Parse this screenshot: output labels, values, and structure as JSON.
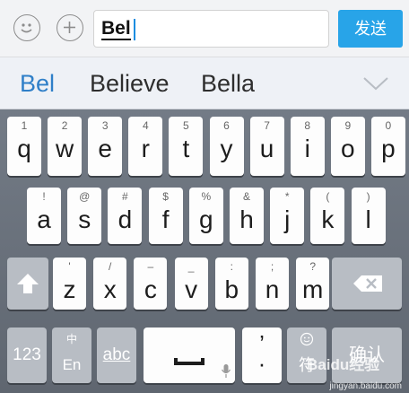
{
  "composer": {
    "input_value": "Bel",
    "send_label": "发送"
  },
  "candidates": [
    "Bel",
    "Believe",
    "Bella"
  ],
  "keyboard": {
    "row1": [
      {
        "hint": "1",
        "key": "q"
      },
      {
        "hint": "2",
        "key": "w"
      },
      {
        "hint": "3",
        "key": "e"
      },
      {
        "hint": "4",
        "key": "r"
      },
      {
        "hint": "5",
        "key": "t"
      },
      {
        "hint": "6",
        "key": "y"
      },
      {
        "hint": "7",
        "key": "u"
      },
      {
        "hint": "8",
        "key": "i"
      },
      {
        "hint": "9",
        "key": "o"
      },
      {
        "hint": "0",
        "key": "p"
      }
    ],
    "row2": [
      {
        "hint": "!",
        "key": "a"
      },
      {
        "hint": "@",
        "key": "s"
      },
      {
        "hint": "#",
        "key": "d"
      },
      {
        "hint": "$",
        "key": "f"
      },
      {
        "hint": "%",
        "key": "g"
      },
      {
        "hint": "&",
        "key": "h"
      },
      {
        "hint": "*",
        "key": "j"
      },
      {
        "hint": "(",
        "key": "k"
      },
      {
        "hint": ")",
        "key": "l"
      }
    ],
    "row3": [
      {
        "hint": "'",
        "key": "z"
      },
      {
        "hint": "/",
        "key": "x"
      },
      {
        "hint": "–",
        "key": "c"
      },
      {
        "hint": "_",
        "key": "v"
      },
      {
        "hint": ":",
        "key": "b"
      },
      {
        "hint": ";",
        "key": "n"
      },
      {
        "hint": "?",
        "key": "m"
      }
    ],
    "num_label": "123",
    "lang_top": "中",
    "lang_bottom": "En",
    "abc_label": "abc",
    "punct_top": "’",
    "punct_bottom": "·",
    "emoji_bottom": "符",
    "enter_label": "确认"
  },
  "watermark": {
    "brand": "Baidu经验",
    "url": "jingyan.baidu.com"
  },
  "colors": {
    "accent": "#28a4e8",
    "candidate_active": "#2f7fc8",
    "keyboard_bg": "#6a717b"
  }
}
